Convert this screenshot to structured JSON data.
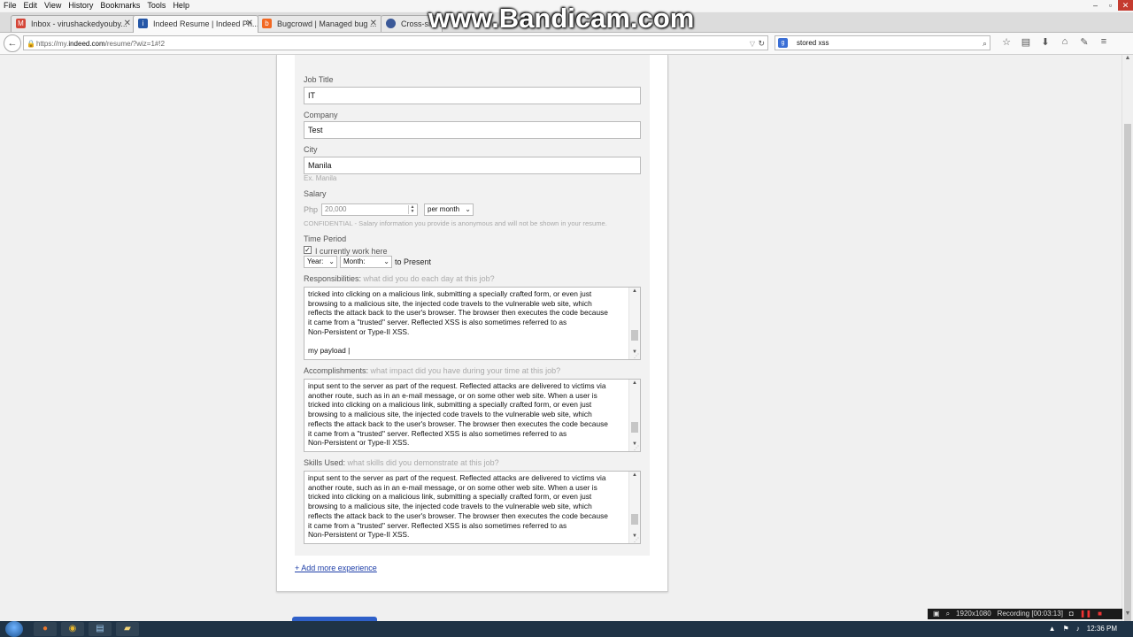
{
  "menubar": [
    "File",
    "Edit",
    "View",
    "History",
    "Bookmarks",
    "Tools",
    "Help"
  ],
  "watermark": "www.Bandicam.com",
  "tabs": [
    {
      "title": "Inbox - virushackedyouby...",
      "icon": "gmail-icon",
      "color": "#d44638"
    },
    {
      "title": "Indeed Resume | Indeed Ph...",
      "icon": "indeed-icon",
      "color": "#2557a7"
    },
    {
      "title": "Bugcrowd | Managed bug ...",
      "icon": "bugcrowd-icon",
      "color": "#f26822"
    },
    {
      "title": "Cross-site ...",
      "icon": "globe-icon",
      "color": "#3b5998"
    }
  ],
  "tab_close": "✕",
  "url": {
    "prefix": "https://my.",
    "domain": "indeed.com",
    "rest": "/resume/?wiz=1#!2"
  },
  "search": {
    "value": "stored xss"
  },
  "form": {
    "job_title_label": "Job Title",
    "job_title": "IT",
    "company_label": "Company",
    "company": "Test",
    "city_label": "City",
    "city": "Manila",
    "city_hint": "Ex. Manila",
    "salary_label": "Salary",
    "currency": "Php",
    "salary": "20,000",
    "period": "per month",
    "salary_note": "CONFIDENTIAL - Salary information you provide is anonymous and will not be shown in your resume.",
    "time_period_label": "Time Period",
    "current_label": "I currently work here",
    "year": "Year:",
    "month": "Month:",
    "to_present": "to Present",
    "resp_label": "Responsibilities:",
    "resp_hint": "what did you do each day at this job?",
    "resp_text": "tricked into clicking on a malicious link, submitting a specially crafted form, or even just\nbrowsing to a malicious site, the injected code travels to the vulnerable web site, which\nreflects the attack back to the user's browser. The browser then executes the code because\nit came from a \"trusted\" server. Reflected XSS is also sometimes referred to as\nNon-Persistent or Type-II XSS.\n\nmy payload |",
    "acc_label": "Accomplishments:",
    "acc_hint": "what impact did you have during your time at this job?",
    "acc_text": "input sent to the server as part of the request. Reflected attacks are delivered to victims via\nanother route, such as in an e-mail message, or on some other web site. When a user is\ntricked into clicking on a malicious link, submitting a specially crafted form, or even just\nbrowsing to a malicious site, the injected code travels to the vulnerable web site, which\nreflects the attack back to the user's browser. The browser then executes the code because\nit came from a \"trusted\" server. Reflected XSS is also sometimes referred to as\nNon-Persistent or Type-II XSS.",
    "skills_label": "Skills Used:",
    "skills_hint": "what skills did you demonstrate at this job?",
    "skills_text": "input sent to the server as part of the request. Reflected attacks are delivered to victims via\nanother route, such as in an e-mail message, or on some other web site. When a user is\ntricked into clicking on a malicious link, submitting a specially crafted form, or even just\nbrowsing to a malicious site, the injected code travels to the vulnerable web site, which\nreflects the attack back to the user's browser. The browser then executes the code because\nit came from a \"trusted\" server. Reflected XSS is also sometimes referred to as\nNon-Persistent or Type-II XSS.",
    "add_more": "+ Add more experience"
  },
  "recording": {
    "resolution": "1920x1080",
    "status": "Recording [00:03:13]"
  },
  "clock": "12:36 PM"
}
